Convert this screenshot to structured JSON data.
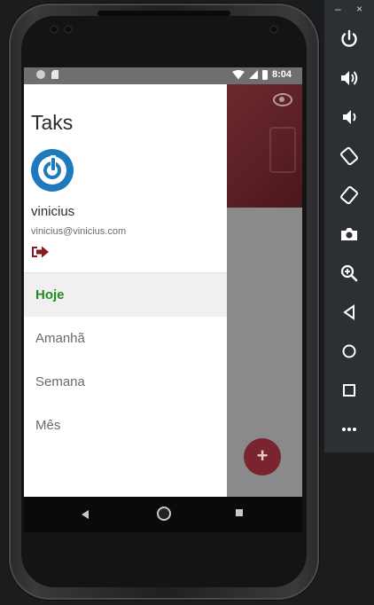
{
  "status_bar": {
    "time": "8:04"
  },
  "drawer": {
    "app_title": "Taks",
    "user": {
      "name": "vinicius",
      "email": "vinicius@vinicius.com"
    },
    "menu": [
      {
        "label": "Hoje",
        "active": true
      },
      {
        "label": "Amanhã",
        "active": false
      },
      {
        "label": "Semana",
        "active": false
      },
      {
        "label": "Mês",
        "active": false
      }
    ]
  },
  "fab": {
    "symbol": "+"
  },
  "emulator_toolbar": {
    "minimize": "–",
    "close": "×",
    "buttons": [
      "power-icon",
      "volume-up-icon",
      "volume-down-icon",
      "rotate-left-icon",
      "rotate-right-icon",
      "camera-icon",
      "zoom-icon",
      "back-icon",
      "home-icon",
      "overview-icon",
      "more-icon"
    ]
  },
  "colors": {
    "accent_active": "#1e8e1e",
    "avatar_blue": "#1e79bd",
    "brand_red": "#7a2430",
    "logout_red": "#8b1a1f"
  }
}
